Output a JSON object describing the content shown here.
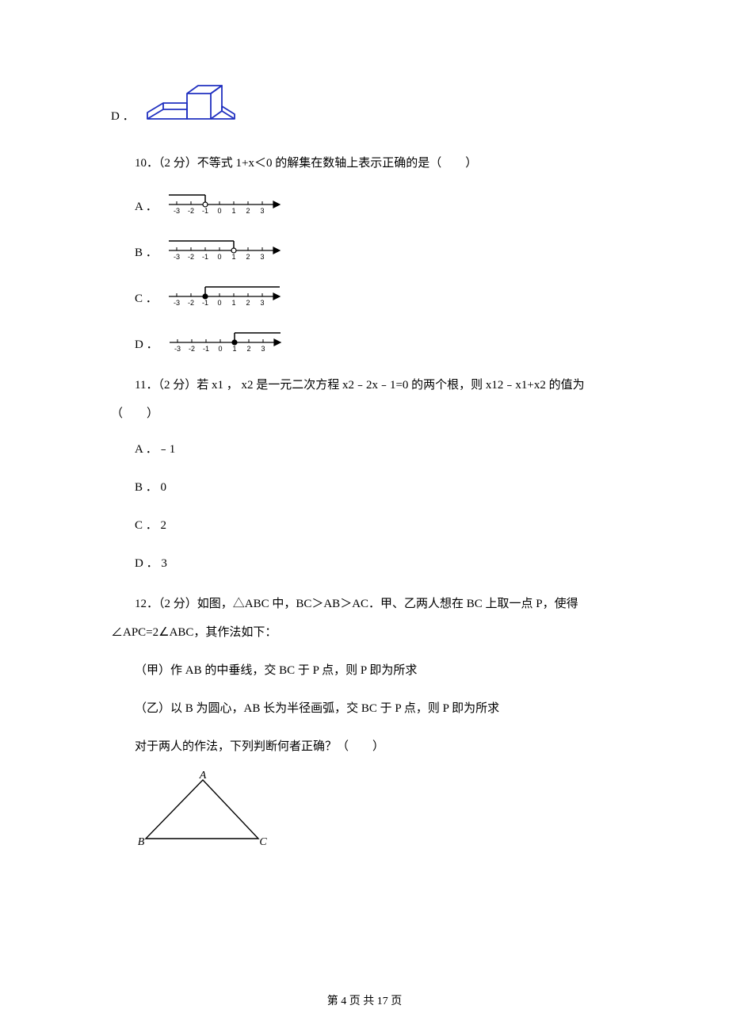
{
  "q9": {
    "optD_label": "D ．"
  },
  "q10": {
    "text": "10．（2 分）不等式 1+x＜0 的解集在数轴上表示正确的是（　　）",
    "optA": "A ．",
    "optB": "B ．",
    "optC": "C ．",
    "optD": "D ．",
    "numberline_labels": [
      "-3",
      "-2",
      "-1",
      "0",
      "1",
      "2",
      "3"
    ]
  },
  "q11": {
    "text": "11．（2 分）若 x1 ， x2 是一元二次方程 x2﹣2x﹣1=0 的两个根，则 x12﹣x1+x2 的值为（　　）",
    "optA": "A ．﹣1",
    "optB": "B ． 0",
    "optC": "C ． 2",
    "optD": "D ． 3"
  },
  "q12": {
    "text1": "12．（2 分）如图，△ABC 中，BC＞AB＞AC．甲、乙两人想在 BC 上取一点 P，使得∠APC=2∠ABC，其作法如下：",
    "text2": "（甲）作 AB 的中垂线，交 BC 于 P 点，则 P 即为所求",
    "text3": "（乙）以 B 为圆心，AB 长为半径画弧，交 BC 于 P 点，则 P 即为所求",
    "text4": "对于两人的作法，下列判断何者正确？（　　）",
    "triangle_labels": {
      "A": "A",
      "B": "B",
      "C": "C"
    }
  },
  "footer": "第 4 页 共 17 页"
}
